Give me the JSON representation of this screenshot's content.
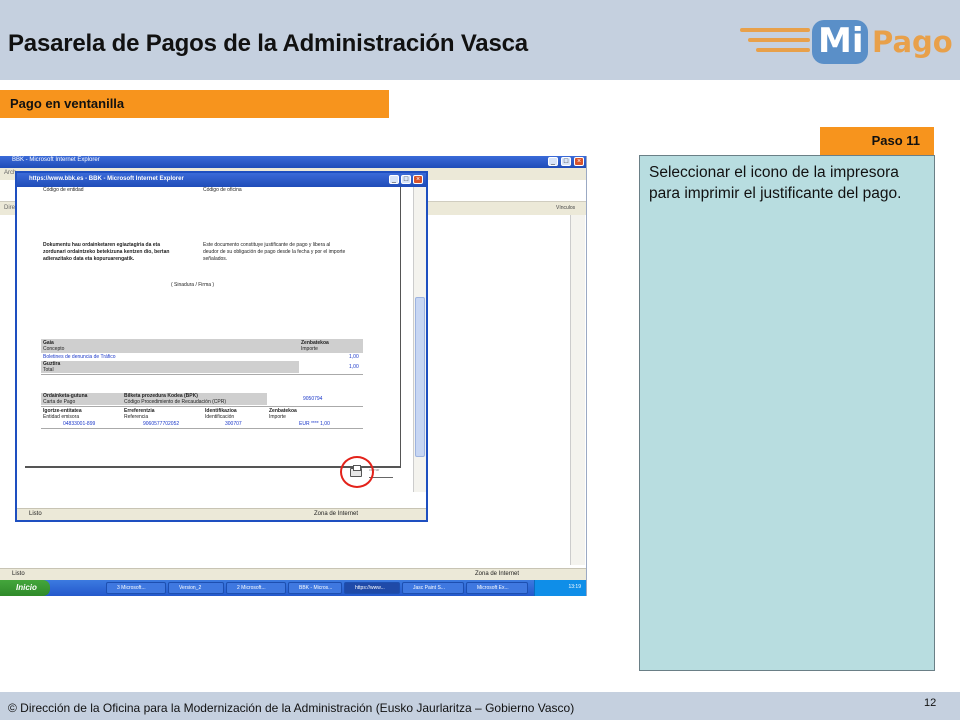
{
  "header": {
    "title": "Pasarela de Pagos de la Administración Vasca",
    "logo": {
      "mi": "Mi",
      "pago": "Pago",
      "colors": {
        "orange": "#e8a04a",
        "blue": "#5a8fc8"
      }
    }
  },
  "section": {
    "label": "Pago en ventanilla"
  },
  "step": {
    "label": "Paso 11"
  },
  "instructions": {
    "text": "Seleccionar el icono de la impresora para imprimir el justificante del pago."
  },
  "screenshot": {
    "outer_window": {
      "title": "BBK - Microsoft Internet Explorer",
      "menu_hint": "Arch",
      "address_hint": "Direcc",
      "links": "Vínculos",
      "status": "Listo",
      "zone": "Zona de Internet"
    },
    "inner_window": {
      "title": "https://www.bbk.es - BBK - Microsoft Internet Explorer",
      "status": "Listo",
      "zone": "Zona de Internet"
    },
    "document": {
      "top_left": "Código de entidad",
      "top_right": "Código de oficina",
      "eu_text": [
        "Dokumentu hau ordainketaren egiaztagiria da eta",
        "zordunari ordaintzeko betekizuna kentzen dio, bertan",
        "adierazitako data eta kopuruarengatik."
      ],
      "es_text": [
        "Este documento constituye justificante de pago y libera al",
        "deudor de su obligación de pago desde la fecha y por el importe",
        "señalados."
      ],
      "signature": "( Sinadura / Firma )",
      "table1": {
        "gaia": "Gaia",
        "concepto": "Concepto",
        "zenbatekoa": "Zenbatekoa",
        "importe": "Importe",
        "row_label": "Boletines de denuncia de Tráfico",
        "row_value": "1,00",
        "guztira": "Guztira",
        "total": "Total",
        "total_value": "1,00"
      },
      "table2": {
        "ordainketa": "Ordainketa-gutuna",
        "carta": "Carta de Pago",
        "biltzeta": "Bilketa prozedura Kodea (BPK)",
        "codigo": "Código Procedimiento de Recaudación (CPR)",
        "cpr_value": "9050794",
        "igortze": "Igortze-entitatea",
        "entidad": "Entidad emisora",
        "entidad_value": "04833001-899",
        "erreferentzia": "Erreferentzia",
        "referencia": "Referencia",
        "referencia_value": "9060577702052",
        "identifikazioa": "Identifikazioa",
        "identificacion": "Identificación",
        "identificacion_value": "300707",
        "zenbatekoa": "Zenbatekoa",
        "importe": "Importe",
        "importe_value": "EUR **** 1,00"
      },
      "cerrar": "cerrar"
    },
    "taskbar": {
      "start": "Inicio",
      "tasks": [
        "3 Microsoft...",
        "Version_2",
        "2 Microsoft...",
        "BBK - Micros...",
        "https://www...",
        "Jasc Paint S...",
        "Microsoft Ex..."
      ],
      "clock": "13:19"
    }
  },
  "footer": {
    "copyright": "© Dirección de la Oficina para la Modernización de la Administración (Eusko Jaurlaritza – Gobierno Vasco)",
    "page": "12"
  }
}
